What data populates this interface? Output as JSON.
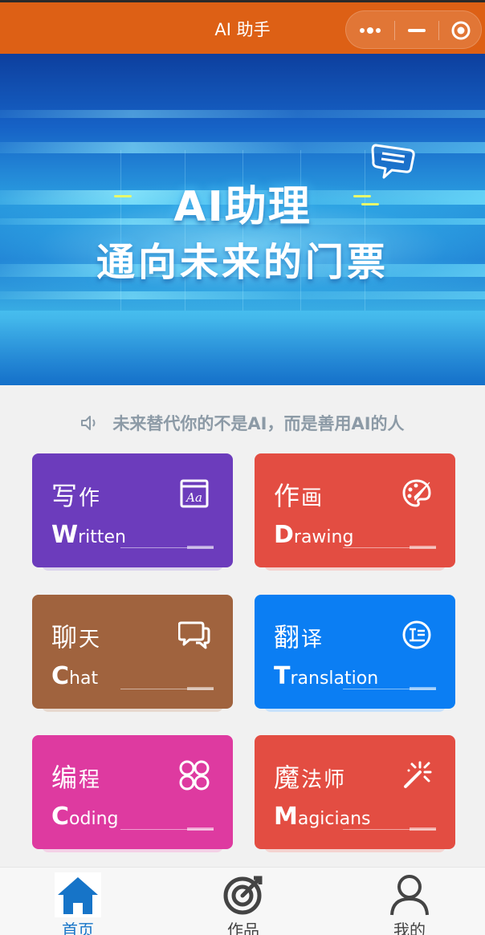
{
  "header": {
    "title": "AI 助手"
  },
  "banner": {
    "line1": "AI助理",
    "line2": "通向未来的门票"
  },
  "notice": {
    "text": "未来替代你的不是AI，而是善用AI的人"
  },
  "cards": [
    {
      "name_first": "写",
      "name_rest": "作",
      "eng_first": "W",
      "eng_rest": "ritten",
      "color": "#6c3cbc",
      "shadow": "#dcd3ec",
      "icon": "font-aa-icon"
    },
    {
      "name_first": "作",
      "name_rest": "画",
      "eng_first": "D",
      "eng_rest": "rawing",
      "color": "#e34d42",
      "shadow": "#f4d3d0",
      "icon": "palette-icon"
    },
    {
      "name_first": "聊",
      "name_rest": "天",
      "eng_first": "C",
      "eng_rest": "hat",
      "color": "#a0633e",
      "shadow": "#e7d9cf",
      "icon": "chat-bubbles-icon"
    },
    {
      "name_first": "翻",
      "name_rest": "译",
      "eng_first": "T",
      "eng_rest": "ranslation",
      "color": "#0b7ef3",
      "shadow": "#c9e2fb",
      "icon": "translate-icon"
    },
    {
      "name_first": "编",
      "name_rest": "程",
      "eng_first": "C",
      "eng_rest": "oding",
      "color": "#de3aa0",
      "shadow": "#f4d0e6",
      "icon": "grid-circles-icon"
    },
    {
      "name_first": "魔",
      "name_rest": "法师",
      "eng_first": "M",
      "eng_rest": "agicians",
      "color": "#e34d42",
      "shadow": "#f4d3d0",
      "icon": "magic-wand-icon"
    }
  ],
  "tabbar": {
    "tabs": [
      {
        "label": "首页",
        "active": true,
        "icon": "home-icon"
      },
      {
        "label": "作品",
        "active": false,
        "icon": "target-icon"
      },
      {
        "label": "我的",
        "active": false,
        "icon": "user-icon"
      }
    ],
    "active_color": "#1674c8",
    "inactive_color": "#444444"
  }
}
